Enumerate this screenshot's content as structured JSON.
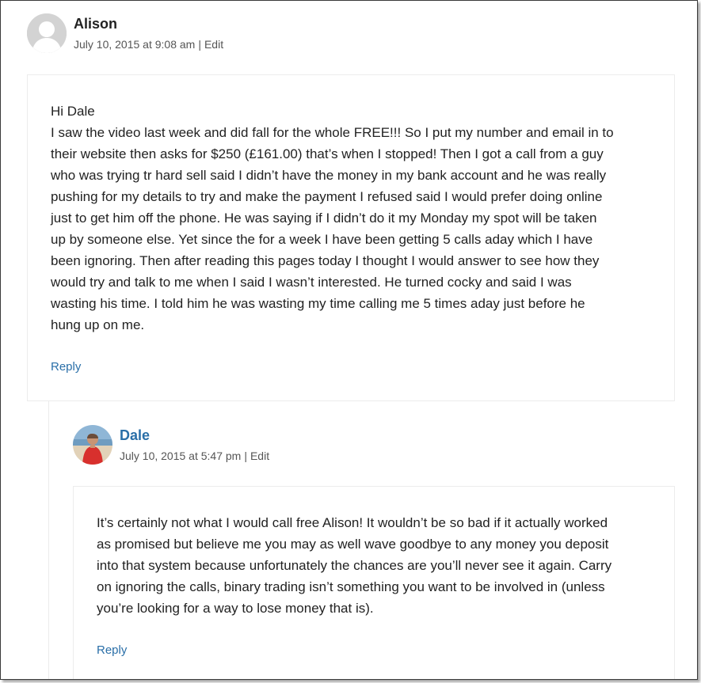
{
  "comments": [
    {
      "author": "Alison",
      "date": "July 10, 2015 at 9:08 am",
      "separator": "|",
      "edit_label": "Edit",
      "body_lines": [
        "Hi Dale",
        "I saw the video last week and did fall for the whole FREE!!! So I put my number and email in to",
        "their website then asks for $250 (£161.00) that’s when I stopped! Then I got a call from a guy",
        "who was trying tr hard sell said I didn’t have the money in my bank account and he was really",
        "pushing for my details to try and make the payment I refused said I would prefer doing online",
        "just to get him off the phone. He was saying if I didn’t do it my Monday my spot will be taken",
        "up by someone else. Yet since the for a week I have been getting 5 calls aday which I have",
        "been ignoring. Then after reading this pages today I thought I would answer to see how they",
        "would try and talk to me when I said I wasn’t interested. He turned cocky and said I was",
        "wasting his time. I told him he was wasting my time calling me 5 times aday just before he",
        "hung up on me."
      ],
      "reply_label": "Reply",
      "avatar_icon": "default-user-avatar"
    },
    {
      "author": "Dale",
      "date": "July 10, 2015 at 5:47 pm",
      "separator": "|",
      "edit_label": "Edit",
      "body_lines": [
        "It’s certainly not what I would call free Alison! It wouldn’t be so bad if it actually worked",
        "as promised but believe me you may as well wave goodbye to any money you deposit",
        "into that system because unfortunately the chances are you’ll never see it again. Carry",
        "on ignoring the calls, binary trading isn’t something you want to be involved in (unless",
        "you’re looking for a way to lose money that is)."
      ],
      "reply_label": "Reply",
      "avatar_icon": "beach-photo-avatar",
      "author_color": "#2a6fa8"
    }
  ],
  "colors": {
    "link": "#2a6fa8",
    "text": "#222222",
    "meta": "#555555",
    "border": "#ececec"
  }
}
